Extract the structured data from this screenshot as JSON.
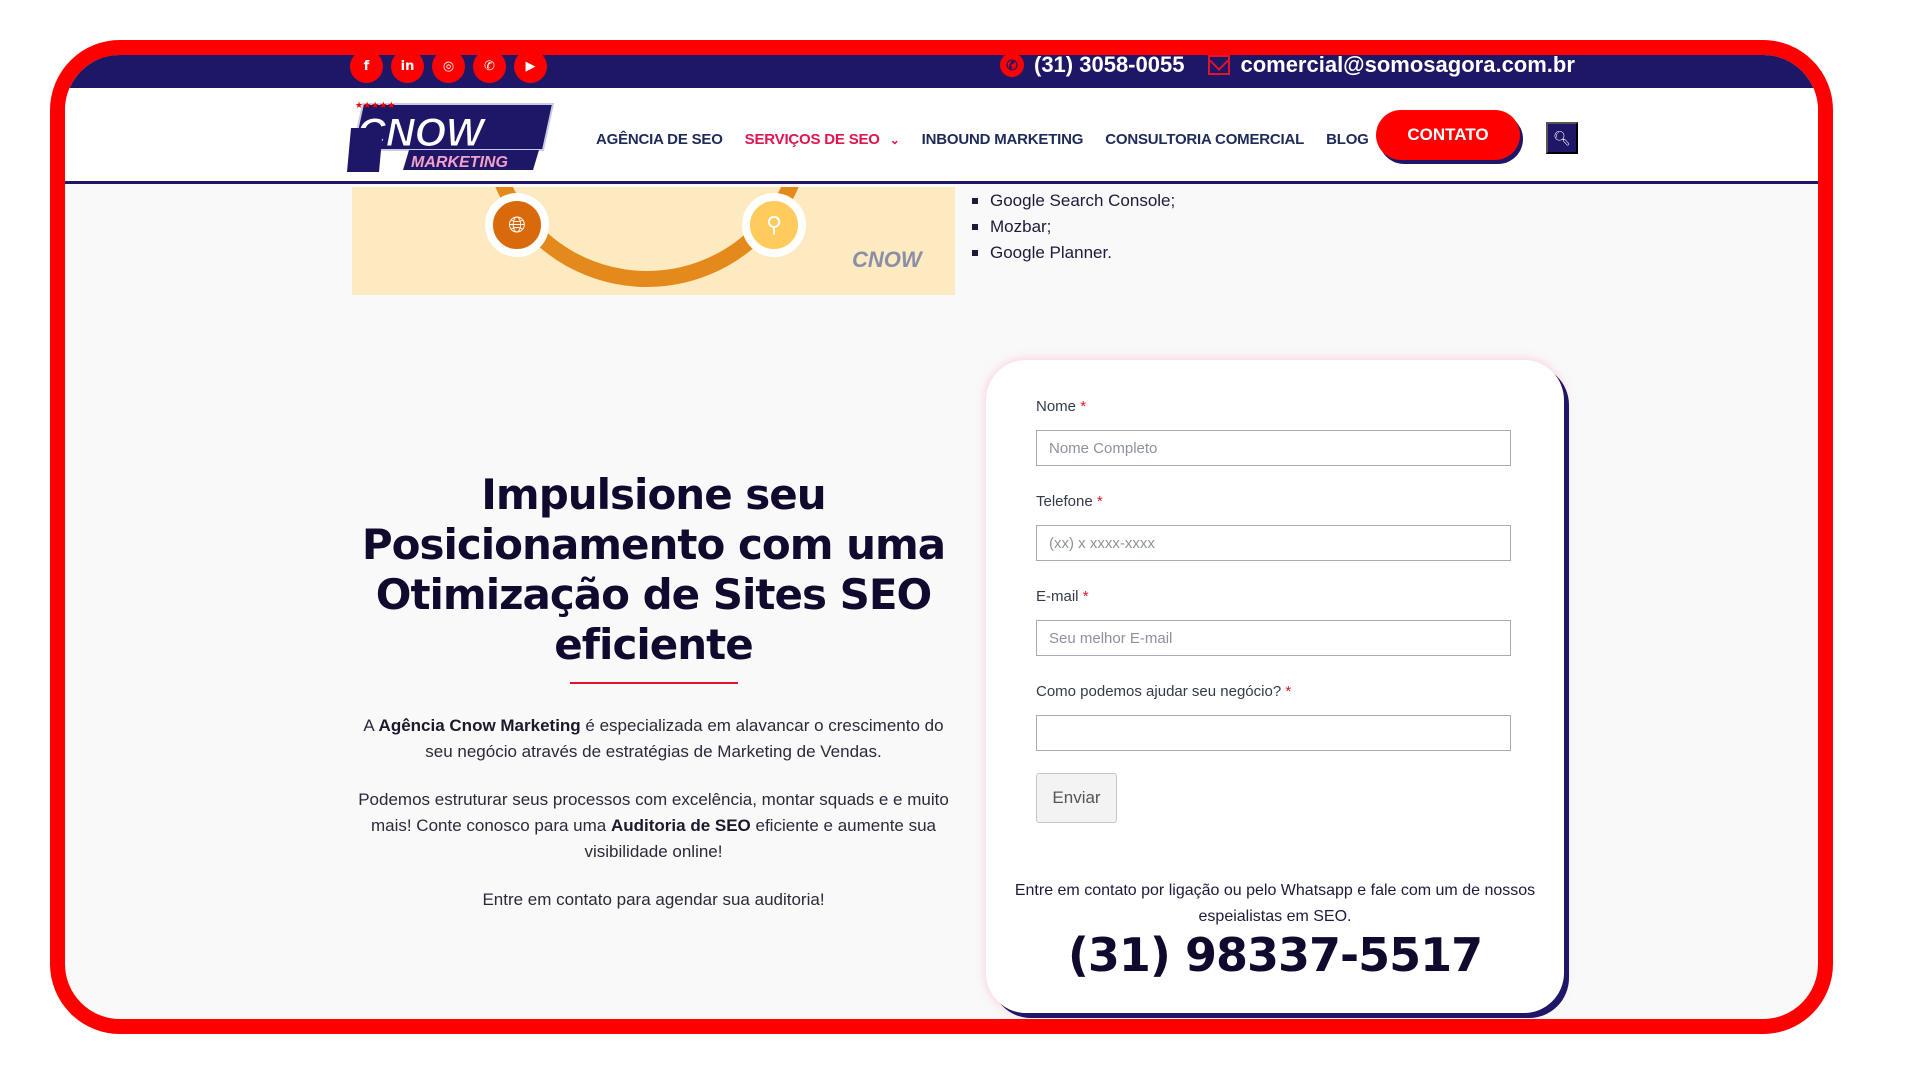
{
  "topbar": {
    "social": [
      {
        "name": "facebook",
        "glyph": "f"
      },
      {
        "name": "linkedin",
        "glyph": "in"
      },
      {
        "name": "instagram",
        "glyph": "◎"
      },
      {
        "name": "whatsapp",
        "glyph": "✆"
      },
      {
        "name": "youtube",
        "glyph": "▶"
      }
    ],
    "phone": "(31) 3058-0055",
    "email": "comercial@somosagora.com.br"
  },
  "header": {
    "logo_top": "CNOW",
    "logo_bottom": "MARKETING",
    "nav": [
      {
        "label": "AGÊNCIA DE SEO",
        "active": false
      },
      {
        "label": "SERVIÇOS DE SEO",
        "active": true
      },
      {
        "label": "INBOUND MARKETING",
        "active": false
      },
      {
        "label": "CONSULTORIA COMERCIAL",
        "active": false
      },
      {
        "label": "BLOG",
        "active": false
      }
    ],
    "contact_button": "CONTATO"
  },
  "tools_list": [
    "Google Search Console;",
    "Mozbar;",
    "Google Planner."
  ],
  "hero": {
    "headline": "Impulsione seu Posicionamento com uma Otimização de Sites SEO eficiente",
    "p1_prefix": "A ",
    "p1_bold": "Agência Cnow Marketing",
    "p1_suffix": " é especializada em alavancar o crescimento do seu negócio através de estratégias de Marketing de Vendas.",
    "p2_prefix": "Podemos estruturar seus processos com excelência, montar squads e e muito mais! Conte conosco para uma ",
    "p2_bold": "Auditoria de SEO",
    "p2_suffix": " eficiente e aumente sua visibilidade online!",
    "p3": "Entre em contato para agendar sua auditoria!"
  },
  "form": {
    "fields": [
      {
        "label": "Nome",
        "required": "*",
        "placeholder": "Nome Completo",
        "value": ""
      },
      {
        "label": "Telefone",
        "required": "*",
        "placeholder": "(xx) x xxxx-xxxx",
        "value": ""
      },
      {
        "label": "E-mail",
        "required": "*",
        "placeholder": "Seu melhor E-mail",
        "value": ""
      },
      {
        "label": "Como podemos ajudar seu negócio?",
        "required": "*",
        "placeholder": "",
        "value": ""
      }
    ],
    "submit": "Enviar",
    "cta_text": "Entre em contato por ligação ou pelo Whatsapp e fale com um de nossos espeialistas em SEO.",
    "cta_phone": "(31) 98337-5517"
  },
  "colors": {
    "brand_navy": "#1e1666",
    "brand_red": "#ff0000",
    "nav_active": "#e0144e"
  }
}
